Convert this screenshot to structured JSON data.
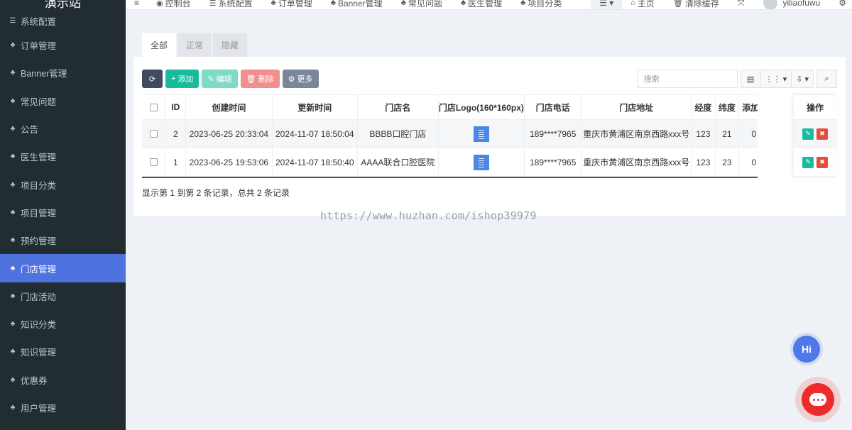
{
  "brand": "演示站",
  "sidebar": {
    "items": [
      {
        "label": "系统配置",
        "icon": "sliders-icon"
      },
      {
        "label": "订单管理",
        "icon": "sitemap-icon"
      },
      {
        "label": "Banner管理",
        "icon": "sitemap-icon"
      },
      {
        "label": "常见问题",
        "icon": "sitemap-icon"
      },
      {
        "label": "公告",
        "icon": "sitemap-icon"
      },
      {
        "label": "医生管理",
        "icon": "sitemap-icon"
      },
      {
        "label": "项目分类",
        "icon": "sitemap-icon"
      },
      {
        "label": "项目管理",
        "icon": "sitemap-icon"
      },
      {
        "label": "预约管理",
        "icon": "sitemap-icon"
      },
      {
        "label": "门店管理",
        "icon": "sitemap-icon",
        "active": true
      },
      {
        "label": "门店活动",
        "icon": "sitemap-icon"
      },
      {
        "label": "知识分类",
        "icon": "sitemap-icon"
      },
      {
        "label": "知识管理",
        "icon": "sitemap-icon"
      },
      {
        "label": "优惠券",
        "icon": "sitemap-icon"
      },
      {
        "label": "用户管理",
        "icon": "sitemap-icon"
      }
    ]
  },
  "topnav": {
    "items": [
      "控制台",
      "系统配置",
      "订单管理",
      "Banner管理",
      "常见问题",
      "医生管理",
      "项目分类"
    ],
    "home": "主页",
    "clear_cache": "清除缓存",
    "username": "yiliaofuwu"
  },
  "tabs": [
    "全部",
    "正常",
    "隐藏"
  ],
  "toolbar": {
    "add": "添加",
    "edit": "编辑",
    "delete": "删除",
    "more": "更多"
  },
  "search": {
    "placeholder": "搜索"
  },
  "table": {
    "headers": [
      "ID",
      "创建时间",
      "更新时间",
      "门店名",
      "门店Logo(160*160px)",
      "门店电话",
      "门店地址",
      "经度",
      "纬度",
      "添加"
    ],
    "ops_header": "操作",
    "rows": [
      {
        "id": "2",
        "created": "2023-06-25 20:33:04",
        "updated": "2024-11-07 18:50:04",
        "name": "BBBB口腔门店",
        "phone": "189****7965",
        "address": "重庆市黄浦区南京西路xxx号",
        "lng": "123",
        "lat": "21",
        "added": "0"
      },
      {
        "id": "1",
        "created": "2023-06-25 19:53:06",
        "updated": "2024-11-07 18:50:40",
        "name": "AAAA联合口腔医院",
        "phone": "189****7965",
        "address": "重庆市黄浦区南京西路xxx号",
        "lng": "123",
        "lat": "23",
        "added": "0"
      }
    ]
  },
  "page_info": "显示第 1 到第 2 条记录，总共 2 条记录",
  "watermark": "https://www.huzhan.com/ishop39979",
  "hi_label": "Hi"
}
